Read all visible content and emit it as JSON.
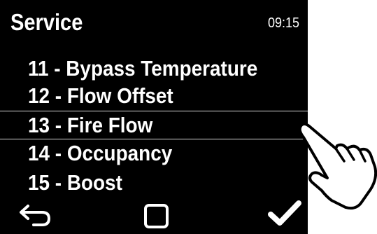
{
  "header": {
    "title": "Service",
    "time": "09:15"
  },
  "menu": {
    "items": [
      {
        "label": "11 - Bypass Temperature",
        "selected": false
      },
      {
        "label": "12 - Flow Offset",
        "selected": false
      },
      {
        "label": "13 - Fire Flow",
        "selected": true
      },
      {
        "label": "14 - Occupancy",
        "selected": false
      },
      {
        "label": "15 - Boost",
        "selected": false
      }
    ]
  },
  "footer": {
    "icons": [
      "back-arrow-icon",
      "square-icon",
      "checkmark-icon"
    ]
  },
  "overlay": {
    "icon": "pointing-hand-icon"
  },
  "colors": {
    "screen_background": "#000000",
    "text": "#ffffff",
    "selection_lines": "#d9d9d9",
    "page_background": "#ffffff"
  }
}
